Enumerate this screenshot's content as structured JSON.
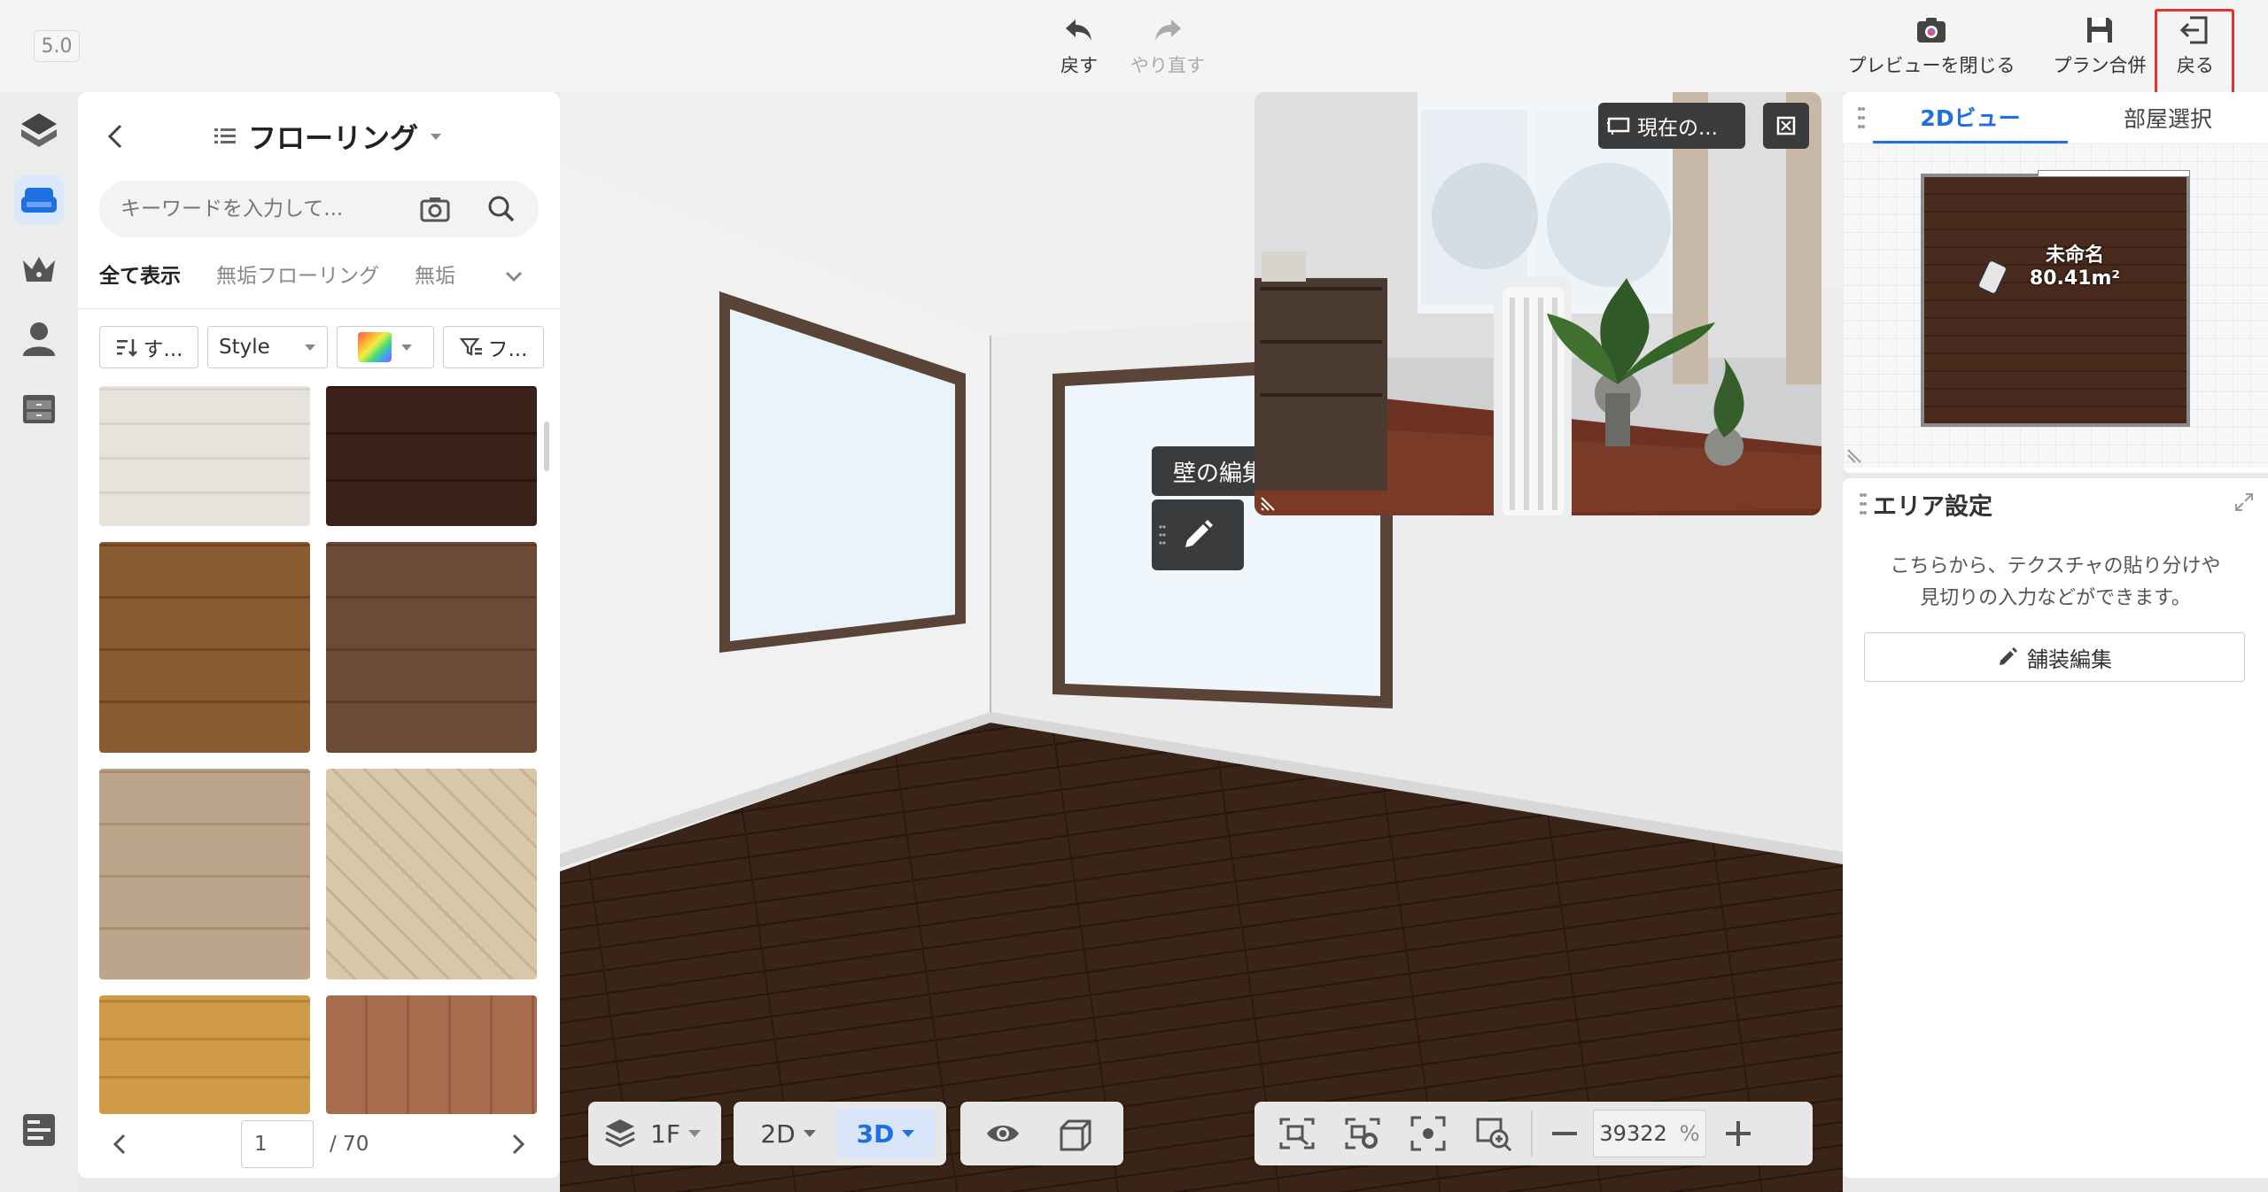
{
  "app": {
    "version": "5.0"
  },
  "toolbar": {
    "undo_label": "戻す",
    "redo_label": "やり直す",
    "close_preview_label": "プレビューを閉じる",
    "plan_merge_label": "プラン合併",
    "back_label": "戻る"
  },
  "left_panel": {
    "title": "フローリング",
    "search_placeholder": "キーワードを入力して...",
    "tabs": [
      "全て表示",
      "無垢フローリング",
      "無垢"
    ],
    "filters": {
      "sort_label": "す...",
      "style_label": "Style",
      "filter_label": "フ..."
    },
    "pagination": {
      "current": "1",
      "total": "/ 70"
    }
  },
  "viewport": {
    "wall_tooltip": "壁の編集",
    "preview_view_label": "現在の...",
    "floor_selector": "1F",
    "mode_2d": "2D",
    "mode_3d": "3D",
    "zoom_value": "39322",
    "zoom_unit": "%"
  },
  "right_panel": {
    "tabs": [
      "2Dビュー",
      "部屋選択"
    ],
    "room_name": "未命名",
    "room_area": "80.41m²",
    "area_settings_title": "エリア設定",
    "area_settings_desc_1": "こちらから、テクスチャの貼り分けや",
    "area_settings_desc_2": "見切りの入力などができます。",
    "paint_edit_label": "舗装編集"
  },
  "colors": {
    "accent": "#1f6fe0",
    "highlight": "#e5322d"
  }
}
